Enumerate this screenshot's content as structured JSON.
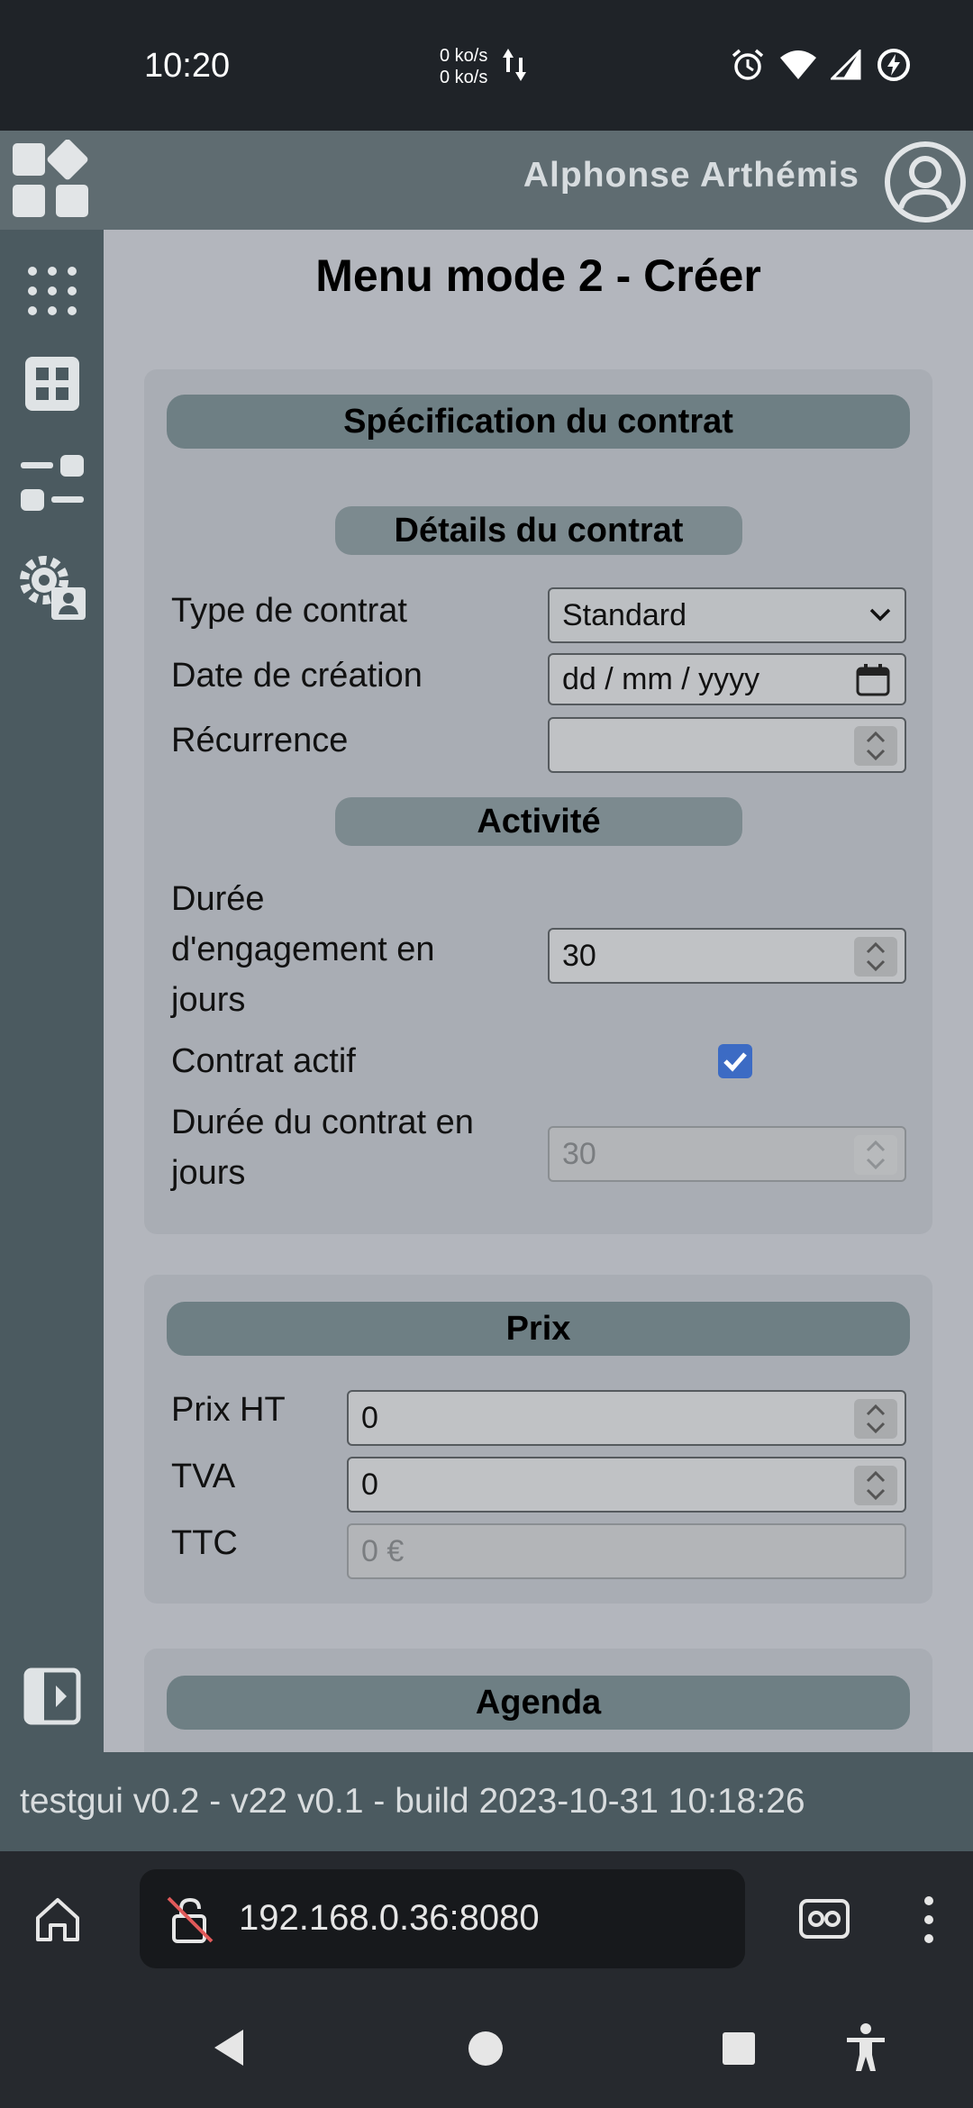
{
  "status_bar": {
    "time": "10:20",
    "net_up": "0 ko/s",
    "net_down": "0 ko/s"
  },
  "header": {
    "user_name": "Alphonse Arthémis"
  },
  "page": {
    "title": "Menu mode 2 - Créer"
  },
  "contract_spec": {
    "header": "Spécification du contrat",
    "details_header": "Détails du contrat",
    "type_label": "Type de contrat",
    "type_value": "Standard",
    "date_label": "Date de création",
    "date_placeholder": "dd / mm / yyyy",
    "recurrence_label": "Récurrence",
    "recurrence_value": "",
    "activity_header": "Activité",
    "engagement_label_1": "Durée",
    "engagement_label_2": "d'engagement en",
    "engagement_label_3": "jours",
    "engagement_value": "30",
    "active_label": "Contrat actif",
    "active_checked": true,
    "duration_label_1": "Durée du contrat en",
    "duration_label_2": "jours",
    "duration_value": "30"
  },
  "price": {
    "header": "Prix",
    "ht_label": "Prix HT",
    "ht_value": "0",
    "tva_label": "TVA",
    "tva_value": "0",
    "ttc_label": "TTC",
    "ttc_value": "0 €"
  },
  "agenda": {
    "header": "Agenda"
  },
  "footer": {
    "build_text": "testgui v0.2 - v22 v0.1 - build 2023-10-31 10:18:26"
  },
  "browser": {
    "url": "192.168.0.36:8080"
  },
  "colors": {
    "accent_checkbox": "#3c6bc4",
    "header_bg": "#5f6c71",
    "sidebar_bg": "#4b5a60"
  }
}
